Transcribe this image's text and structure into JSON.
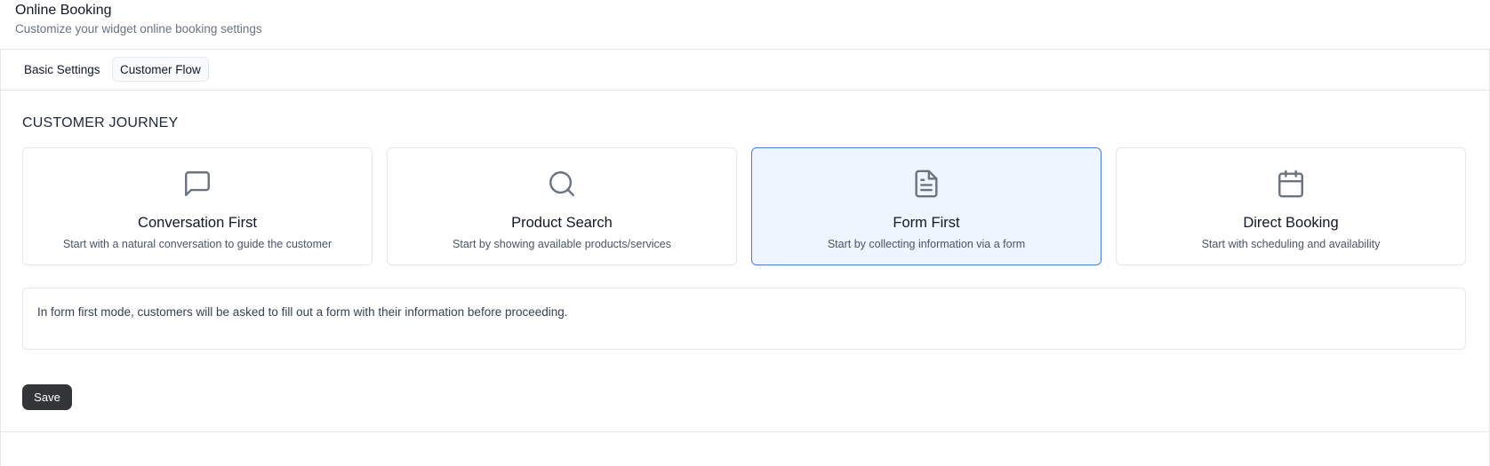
{
  "header": {
    "title": "Online Booking",
    "subtitle": "Customize your widget online booking settings"
  },
  "tabs": [
    {
      "label": "Basic Settings",
      "active": false
    },
    {
      "label": "Customer Flow",
      "active": true
    }
  ],
  "journey": {
    "heading": "CUSTOMER JOURNEY",
    "selected_index": 2,
    "options": [
      {
        "icon": "chat-bubble-icon",
        "title": "Conversation First",
        "description": "Start with a natural conversation to guide the customer"
      },
      {
        "icon": "search-icon",
        "title": "Product Search",
        "description": "Start by showing available products/services"
      },
      {
        "icon": "document-icon",
        "title": "Form First",
        "description": "Start by collecting information via a form"
      },
      {
        "icon": "calendar-icon",
        "title": "Direct Booking",
        "description": "Start with scheduling and availability"
      }
    ]
  },
  "info": {
    "text": "In form first mode, customers will be asked to fill out a form with their information before proceeding."
  },
  "actions": {
    "save_label": "Save"
  },
  "colors": {
    "selected_background": "#eef5fe",
    "selected_border": "#4a7fd4",
    "save_button": "#333538",
    "border": "#e5e7eb"
  }
}
